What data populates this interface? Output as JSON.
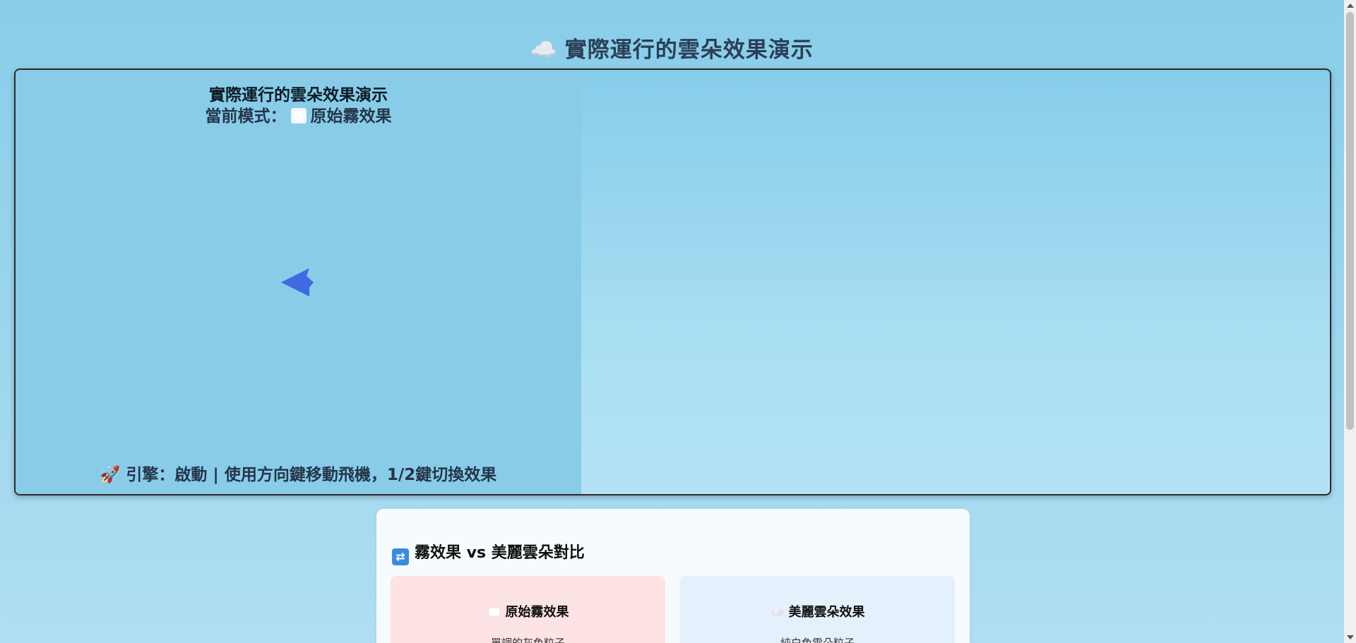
{
  "page": {
    "title_emoji": "☁️",
    "title": "實際運行的雲朵效果演示"
  },
  "game": {
    "hud_title": "實際運行的雲朵效果演示",
    "mode_label": "當前模式：",
    "mode_value": "原始霧效果",
    "status_emoji": "🚀",
    "status_text": "引擎：啟動 | 使用方向鍵移動飛機，1/2鍵切換效果",
    "plane_color": "#4169e1"
  },
  "comparison": {
    "heading": "霧效果 vs 美麗雲朵對比",
    "cards": [
      {
        "title": "原始霧效果",
        "description": "單調的灰色粒子",
        "bg_color": "#fde3e3"
      },
      {
        "title": "美麗雲朵效果",
        "description": "純白色雲朵粒子",
        "bg_color": "#e4f0fb"
      }
    ]
  }
}
